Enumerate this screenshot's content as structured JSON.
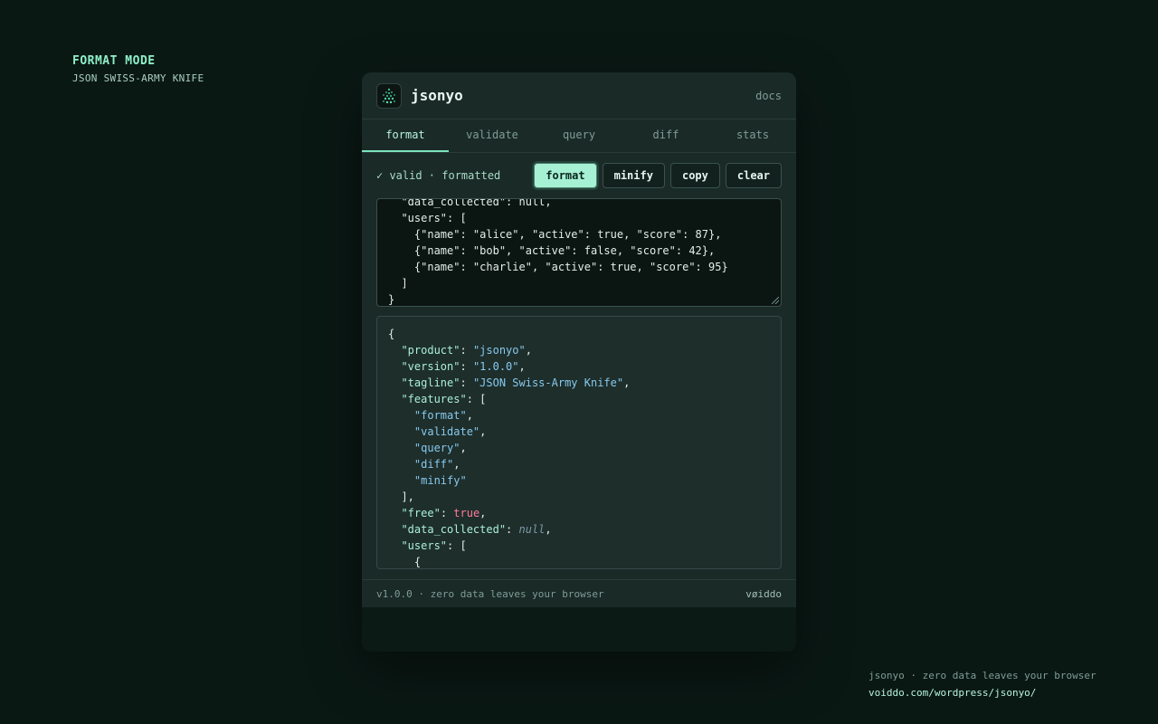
{
  "caption": {
    "mode": "FORMAT MODE",
    "subtitle": "JSON SWISS-ARMY KNIFE"
  },
  "app": {
    "title": "jsonyo",
    "docs_label": "docs"
  },
  "tabs": [
    {
      "label": "format",
      "active": true
    },
    {
      "label": "validate",
      "active": false
    },
    {
      "label": "query",
      "active": false
    },
    {
      "label": "diff",
      "active": false
    },
    {
      "label": "stats",
      "active": false
    }
  ],
  "toolbar": {
    "status": "✓ valid · formatted",
    "format_label": "format",
    "minify_label": "minify",
    "copy_label": "copy",
    "clear_label": "clear"
  },
  "input": {
    "value": "  \"data_collected\": null,\n  \"users\": [\n    {\"name\": \"alice\", \"active\": true, \"score\": 87},\n    {\"name\": \"bob\", \"active\": false, \"score\": 42},\n    {\"name\": \"charlie\", \"active\": true, \"score\": 95}\n  ]\n}"
  },
  "output": {
    "lines": [
      [
        {
          "t": "{",
          "c": "p"
        }
      ],
      [
        {
          "t": "  ",
          "c": "p"
        },
        {
          "t": "\"product\"",
          "c": "k"
        },
        {
          "t": ": ",
          "c": "p"
        },
        {
          "t": "\"jsonyo\"",
          "c": "s"
        },
        {
          "t": ",",
          "c": "p"
        }
      ],
      [
        {
          "t": "  ",
          "c": "p"
        },
        {
          "t": "\"version\"",
          "c": "k"
        },
        {
          "t": ": ",
          "c": "p"
        },
        {
          "t": "\"1.0.0\"",
          "c": "s"
        },
        {
          "t": ",",
          "c": "p"
        }
      ],
      [
        {
          "t": "  ",
          "c": "p"
        },
        {
          "t": "\"tagline\"",
          "c": "k"
        },
        {
          "t": ": ",
          "c": "p"
        },
        {
          "t": "\"JSON Swiss-Army Knife\"",
          "c": "s"
        },
        {
          "t": ",",
          "c": "p"
        }
      ],
      [
        {
          "t": "  ",
          "c": "p"
        },
        {
          "t": "\"features\"",
          "c": "k"
        },
        {
          "t": ": [",
          "c": "p"
        }
      ],
      [
        {
          "t": "    ",
          "c": "p"
        },
        {
          "t": "\"format\"",
          "c": "s"
        },
        {
          "t": ",",
          "c": "p"
        }
      ],
      [
        {
          "t": "    ",
          "c": "p"
        },
        {
          "t": "\"validate\"",
          "c": "s"
        },
        {
          "t": ",",
          "c": "p"
        }
      ],
      [
        {
          "t": "    ",
          "c": "p"
        },
        {
          "t": "\"query\"",
          "c": "s"
        },
        {
          "t": ",",
          "c": "p"
        }
      ],
      [
        {
          "t": "    ",
          "c": "p"
        },
        {
          "t": "\"diff\"",
          "c": "s"
        },
        {
          "t": ",",
          "c": "p"
        }
      ],
      [
        {
          "t": "    ",
          "c": "p"
        },
        {
          "t": "\"minify\"",
          "c": "s"
        }
      ],
      [
        {
          "t": "  ],",
          "c": "p"
        }
      ],
      [
        {
          "t": "  ",
          "c": "p"
        },
        {
          "t": "\"free\"",
          "c": "k"
        },
        {
          "t": ": ",
          "c": "p"
        },
        {
          "t": "true",
          "c": "b"
        },
        {
          "t": ",",
          "c": "p"
        }
      ],
      [
        {
          "t": "  ",
          "c": "p"
        },
        {
          "t": "\"data_collected\"",
          "c": "k"
        },
        {
          "t": ": ",
          "c": "p"
        },
        {
          "t": "null",
          "c": "n"
        },
        {
          "t": ",",
          "c": "p"
        }
      ],
      [
        {
          "t": "  ",
          "c": "p"
        },
        {
          "t": "\"users\"",
          "c": "k"
        },
        {
          "t": ": [",
          "c": "p"
        }
      ],
      [
        {
          "t": "    {",
          "c": "p"
        }
      ]
    ]
  },
  "footer": {
    "version_text": "v1.0.0 · zero data leaves your browser",
    "brand": "vøiddo"
  },
  "bottom_note": {
    "line1": "jsonyo · zero data leaves your browser",
    "line2": "voiddo.com/wordpress/jsonyo/"
  },
  "colors": {
    "accent": "#a6f1d3",
    "key": "#a9f0d6",
    "string": "#86c9ee",
    "boolean": "#ff7b9a",
    "null": "#7e98a6"
  }
}
